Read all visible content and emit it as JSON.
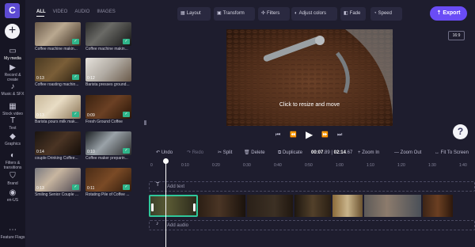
{
  "nav": {
    "logo": "C",
    "add": "+",
    "items": [
      {
        "label": "My media",
        "icon": "▭"
      },
      {
        "label": "Record & create",
        "icon": "▶"
      },
      {
        "label": "Music & SFX",
        "icon": "♪"
      },
      {
        "label": "Stock video",
        "icon": "▦"
      },
      {
        "label": "Text",
        "icon": "T"
      },
      {
        "label": "Graphics",
        "icon": "◆"
      },
      {
        "label": "Filters & transitions",
        "icon": "◐"
      },
      {
        "label": "Brand",
        "icon": "⛉"
      },
      {
        "label": "en-US",
        "icon": "◉"
      },
      {
        "label": "Feature Flags",
        "icon": "⋯"
      }
    ]
  },
  "media_tabs": [
    "ALL",
    "VIDEO",
    "AUDIO",
    "IMAGES"
  ],
  "media": [
    {
      "caption": "Coffee machine makin...",
      "duration": "",
      "checked": true
    },
    {
      "caption": "Coffee machine makin...",
      "duration": "",
      "checked": true
    },
    {
      "caption": "Coffee roasting machin...",
      "duration": "0:13",
      "checked": true
    },
    {
      "caption": "Barista presses ground...",
      "duration": "0:12",
      "checked": false
    },
    {
      "caption": "Barista pours milk mak...",
      "duration": "0:13",
      "checked": true
    },
    {
      "caption": "Fresh Ground Coffee",
      "duration": "0:09",
      "checked": true
    },
    {
      "caption": "couple Drinking Coffee...",
      "duration": "0:14",
      "checked": false
    },
    {
      "caption": "Coffee maker preparin...",
      "duration": "0:10",
      "checked": true
    },
    {
      "caption": "Smiling Senior Couple ...",
      "duration": "0:13",
      "checked": true
    },
    {
      "caption": "Rotating Pile of Coffee ...",
      "duration": "0:11",
      "checked": true
    }
  ],
  "toolbar": {
    "buttons": [
      {
        "label": "Layout",
        "icon": "▦"
      },
      {
        "label": "Transform",
        "icon": "▣"
      },
      {
        "label": "Filters",
        "icon": "✣"
      },
      {
        "label": "Adjust colors",
        "icon": "◐"
      },
      {
        "label": "Fade",
        "icon": "◧"
      },
      {
        "label": "Speed",
        "icon": "◔"
      }
    ],
    "export_label": "Export",
    "export_icon": "⇡",
    "ratio": "16:9"
  },
  "preview": {
    "hint": "Click to resize and move"
  },
  "help": "?",
  "timeline_toolbar": {
    "undo": "Undo",
    "redo": "Redo",
    "split": "Split",
    "delete": "Delete",
    "duplicate": "Duplicate",
    "time_current": "00:07",
    "time_current_frac": ".89",
    "time_total": "02:14",
    "time_total_frac": ".67",
    "zoom_in": "Zoom In",
    "zoom_out": "Zoom Out",
    "fit": "Fit To Screen"
  },
  "ruler": [
    "0",
    "0:10",
    "0:20",
    "0:30",
    "0:40",
    "0:50",
    "1:00",
    "1:10",
    "1:20",
    "1:30",
    "1:40"
  ],
  "tracks": {
    "text": "Add text",
    "audio": "Add audio"
  },
  "colors": {
    "accent": "#6a4cf6",
    "check": "#2fb58a",
    "selection": "#2fc79a"
  }
}
